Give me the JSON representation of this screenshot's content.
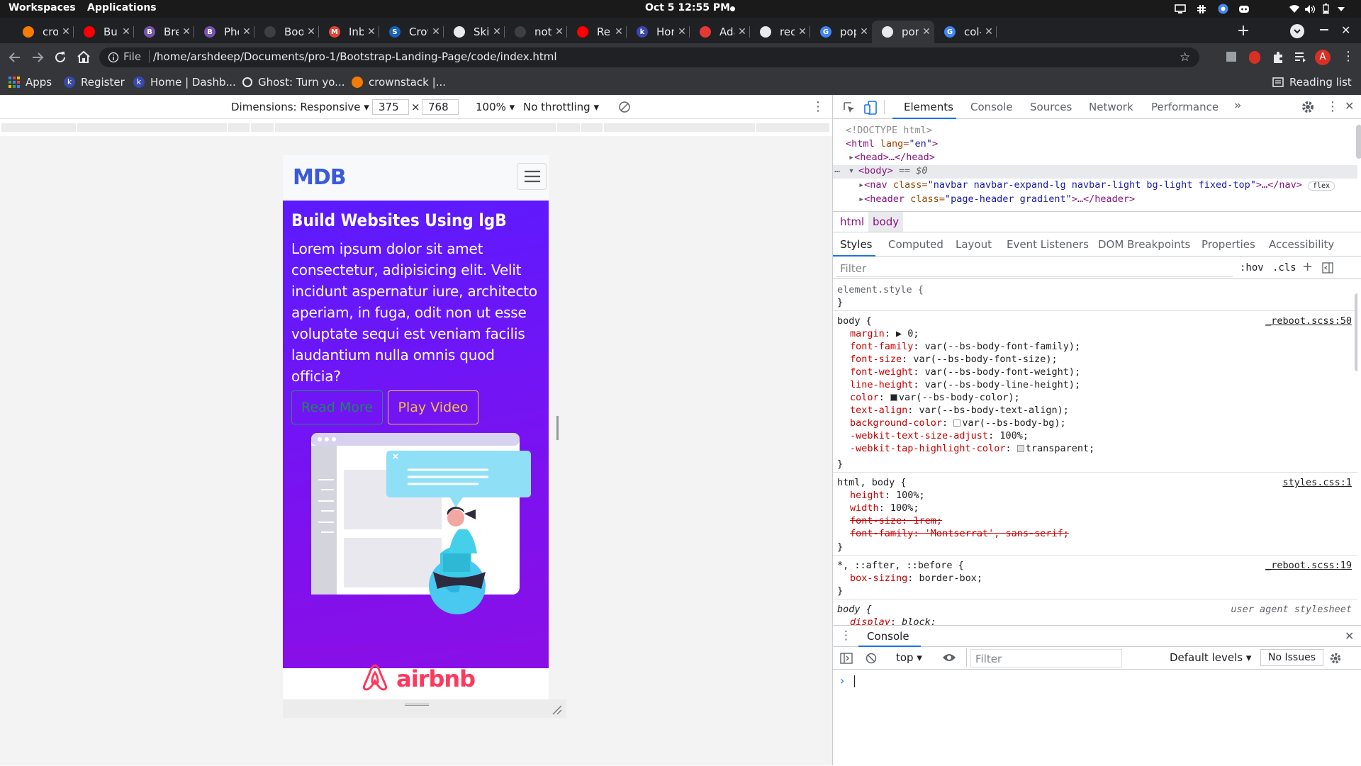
{
  "topbar": {
    "workspaces": "Workspaces",
    "applications": "Applications",
    "clock": "Oct 5  12:55 PM"
  },
  "tabs": [
    {
      "title": "crown",
      "fav_color": "#f57c00"
    },
    {
      "title": "Build",
      "fav_color": "#ff0000"
    },
    {
      "title": "Break",
      "fav_color": "#7952b3",
      "fav_letter": "B"
    },
    {
      "title": "Phone",
      "fav_color": "#7952b3",
      "fav_letter": "B"
    },
    {
      "title": "Boots",
      "fav_color": "#3c4043"
    },
    {
      "title": "Inbox",
      "fav_color": "#ea4335",
      "fav_letter": "M"
    },
    {
      "title": "Crown",
      "fav_color": "#1565c0",
      "fav_letter": "S"
    },
    {
      "title": "Skia",
      "fav_color": "#e8eaed"
    },
    {
      "title": "notas",
      "fav_color": "#3c4043"
    },
    {
      "title": "Relax",
      "fav_color": "#ff0000"
    },
    {
      "title": "Home",
      "fav_color": "#3949ab",
      "fav_letter": "k"
    },
    {
      "title": "Adapt",
      "fav_color": "#e53935"
    },
    {
      "title": "recen",
      "fav_color": "#e8eaed"
    },
    {
      "title": "popp",
      "fav_color": "#4285f4",
      "fav_letter": "G"
    },
    {
      "title": "portfo",
      "fav_color": "#e8eaed"
    },
    {
      "title": "col-m",
      "fav_color": "#4285f4",
      "fav_letter": "G"
    }
  ],
  "omnibox": {
    "scheme": "File",
    "url": "/home/arshdeep/Documents/pro-1/Bootstrap-Landing-Page/code/index.html"
  },
  "bookmarks": {
    "apps": "Apps",
    "items": [
      "Register",
      "Home | Dashb...",
      "Ghost: Turn yo...",
      "crownstack |..."
    ],
    "reading_list": "Reading list"
  },
  "device_toolbar": {
    "dimensions": "Dimensions: Responsive",
    "width": "375",
    "times": "×",
    "height": "768",
    "zoom": "100%",
    "throttling": "No throttling"
  },
  "page": {
    "brand": "MDB",
    "hero_title": "Build Websites Using lgB",
    "hero_text": "Lorem ipsum dolor sit amet consectetur, adipisicing elit. Velit incidunt aspernatur iure, architecto aperiam, in fuga, odit non ut esse voluptate sequi est veniam facilis laudantium nulla omnis quod officia?",
    "read_more": "Read More",
    "play_video": "Play Video",
    "airbnb": "airbnb"
  },
  "devtools": {
    "tabs": [
      "Elements",
      "Console",
      "Sources",
      "Network",
      "Performance"
    ],
    "more_tabs": "»",
    "dom": {
      "doctype": "<!DOCTYPE html>",
      "html_open_tag": "<html",
      "html_lang_attr": " lang=",
      "html_lang_val": "\"en\"",
      "close_bracket": ">",
      "head": "<head>…</head>",
      "body_tag": "<body>",
      "body_eq": " == $0",
      "nav_tag": "<nav",
      "nav_class_attr": " class=",
      "nav_class_val": "\"navbar navbar-expand-lg navbar-light bg-light fixed-top\"",
      "nav_rest": ">…</nav>",
      "flex_badge": "flex",
      "header_tag": "<header",
      "header_class_attr": " class=",
      "header_class_val": "\"page-header gradient\"",
      "header_rest": ">…</header>"
    },
    "breadcrumbs": [
      "html",
      "body"
    ],
    "subtabs": [
      "Styles",
      "Computed",
      "Layout",
      "Event Listeners",
      "DOM Breakpoints",
      "Properties",
      "Accessibility"
    ],
    "filter_placeholder": "Filter",
    "hov": ":hov",
    "cls": ".cls",
    "rules": {
      "element_style": "element.style {",
      "close": "}",
      "body_selector": "body {",
      "body_source": "_reboot.scss:50",
      "body_decls": [
        {
          "prop": "margin",
          "val": "▶ 0;"
        },
        {
          "prop": "font-family",
          "val": "var(--bs-body-font-family);"
        },
        {
          "prop": "font-size",
          "val": "var(--bs-body-font-size);"
        },
        {
          "prop": "font-weight",
          "val": "var(--bs-body-font-weight);"
        },
        {
          "prop": "line-height",
          "val": "var(--bs-body-line-height);"
        },
        {
          "prop": "color",
          "val": "var(--bs-body-color);"
        },
        {
          "prop": "text-align",
          "val": "var(--bs-body-text-align);"
        },
        {
          "prop": "background-color",
          "val": "var(--bs-body-bg);"
        },
        {
          "prop": "-webkit-text-size-adjust",
          "val": "100%;"
        },
        {
          "prop": "-webkit-tap-highlight-color",
          "val": "transparent;"
        }
      ],
      "htmlbody_selector": "html, body {",
      "htmlbody_source": "styles.css:1",
      "htmlbody_decls": [
        {
          "prop": "height",
          "val": "100%;"
        },
        {
          "prop": "width",
          "val": "100%;"
        },
        {
          "prop": "font-size",
          "val": "1rem;"
        },
        {
          "prop": "font-family",
          "val": "'Montserrat', sans-serif;"
        }
      ],
      "star_selector": "*, ::after, ::before {",
      "star_source": "_reboot.scss:19",
      "star_decls": [
        {
          "prop": "box-sizing",
          "val": "border-box;"
        }
      ],
      "ua_selector": "body {",
      "ua_source": "user agent stylesheet",
      "ua_decls": [
        {
          "prop": "display",
          "val": "block;"
        }
      ]
    },
    "console": {
      "title": "Console",
      "context": "top",
      "filter_placeholder": "Filter",
      "levels": "Default levels",
      "issues": "No Issues",
      "prompt": "›"
    }
  }
}
